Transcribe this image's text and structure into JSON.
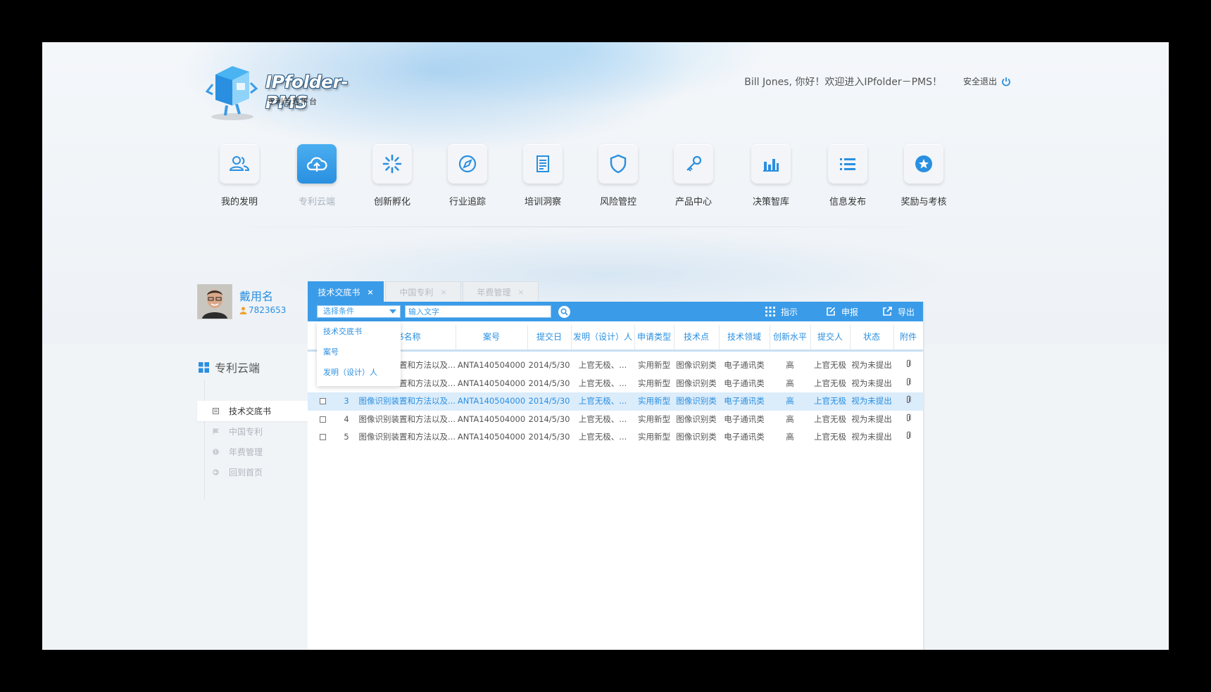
{
  "app": {
    "logo_title": "IPfolder-PMS",
    "logo_subtitle": "专利管理平台",
    "welcome": "Bill Jones, 你好！欢迎进入IPfolder－PMS！",
    "logout": "安全退出"
  },
  "nav": [
    {
      "label": "我的发明",
      "icon": "users-icon"
    },
    {
      "label": "专利云端",
      "icon": "cloud-upload-icon",
      "active": true
    },
    {
      "label": "创新孵化",
      "icon": "loading-icon"
    },
    {
      "label": "行业追踪",
      "icon": "compass-icon"
    },
    {
      "label": "培训洞察",
      "icon": "document-icon"
    },
    {
      "label": "风险管控",
      "icon": "shield-icon"
    },
    {
      "label": "产品中心",
      "icon": "key-icon"
    },
    {
      "label": "决策智库",
      "icon": "bar-chart-icon"
    },
    {
      "label": "信息发布",
      "icon": "list-icon"
    },
    {
      "label": "奖励与考核",
      "icon": "star-badge-icon"
    }
  ],
  "profile": {
    "name": "戴用名",
    "id": "7823653"
  },
  "sidebar": {
    "title": "专利云端",
    "items": [
      {
        "label": "技术交底书",
        "active": true
      },
      {
        "label": "中国专利"
      },
      {
        "label": "年费管理"
      },
      {
        "label": "回到首页"
      }
    ]
  },
  "tabs": [
    {
      "label": "技术交底书",
      "close": "×",
      "active": true
    },
    {
      "label": "中国专利",
      "close": "×"
    },
    {
      "label": "年费管理",
      "close": "×"
    }
  ],
  "toolbar": {
    "select_value": "选择条件",
    "search_placeholder": "输入文字",
    "btn_indicate": "指示",
    "btn_declare": "申报",
    "btn_export": "导出"
  },
  "dropdown_options": [
    "技术交底书",
    "案号",
    "发明（设计）人"
  ],
  "table": {
    "headers": [
      "书名称",
      "案号",
      "提交日",
      "发明（设计）人",
      "申请类型",
      "技术点",
      "技术领域",
      "创新水平",
      "提交人",
      "状态",
      "附件"
    ],
    "rows": [
      {
        "num": "",
        "name": "置和方法以及...",
        "case": "ANTA140504000",
        "date": "2014/5/30",
        "inventor": "上官无极、...",
        "type": "实用新型",
        "point": "图像识别类",
        "field": "电子通讯类",
        "level": "高",
        "submitter": "上官无极",
        "status": "视为未提出"
      },
      {
        "num": "",
        "name": "置和方法以及...",
        "case": "ANTA140504000",
        "date": "2014/5/30",
        "inventor": "上官无极、...",
        "type": "实用新型",
        "point": "图像识别类",
        "field": "电子通讯类",
        "level": "高",
        "submitter": "上官无极",
        "status": "视为未提出"
      },
      {
        "num": "3",
        "name": "图像识别装置和方法以及...",
        "case": "ANTA140504000",
        "date": "2014/5/30",
        "inventor": "上官无极、...",
        "type": "实用新型",
        "point": "图像识别类",
        "field": "电子通讯类",
        "level": "高",
        "submitter": "上官无极",
        "status": "视为未提出",
        "selected": true
      },
      {
        "num": "4",
        "name": "图像识别装置和方法以及...",
        "case": "ANTA140504000",
        "date": "2014/5/30",
        "inventor": "上官无极、...",
        "type": "实用新型",
        "point": "图像识别类",
        "field": "电子通讯类",
        "level": "高",
        "submitter": "上官无极",
        "status": "视为未提出"
      },
      {
        "num": "5",
        "name": "图像识别装置和方法以及...",
        "case": "ANTA140504000",
        "date": "2014/5/30",
        "inventor": "上官无极、...",
        "type": "实用新型",
        "point": "图像识别类",
        "field": "电子通讯类",
        "level": "高",
        "submitter": "上官无极",
        "status": "视为未提出"
      }
    ]
  },
  "colors": {
    "accent": "#3a9be8",
    "accent_text": "#2a8fe0",
    "selected_row": "#dbecfb"
  }
}
